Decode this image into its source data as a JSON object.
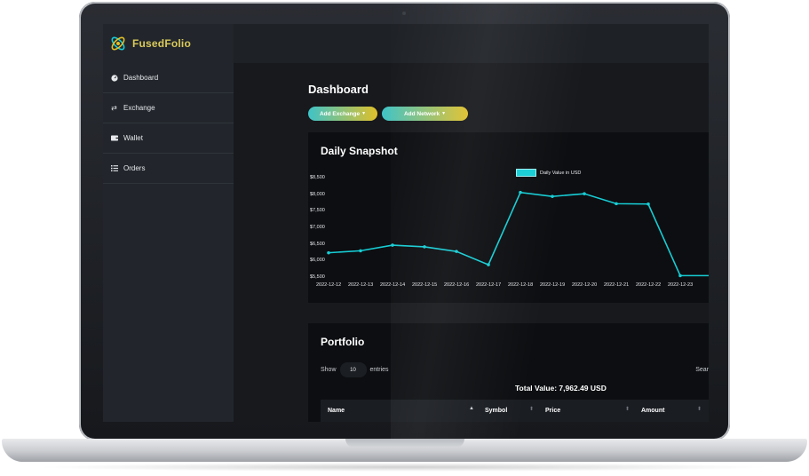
{
  "app": {
    "name": "FusedFolio"
  },
  "sidebar": {
    "items": [
      {
        "label": "Dashboard",
        "icon": "dashboard-icon"
      },
      {
        "label": "Exchange",
        "icon": "exchange-arrows-icon"
      },
      {
        "label": "Wallet",
        "icon": "wallet-icon"
      },
      {
        "label": "Orders",
        "icon": "orders-list-icon"
      }
    ]
  },
  "main": {
    "title": "Dashboard",
    "add_exchange_label": "Add Exchange",
    "add_network_label": "Add Network"
  },
  "snapshot": {
    "title": "Daily Snapshot"
  },
  "portfolio": {
    "title": "Portfolio",
    "show_label": "Show",
    "entries_value": "10",
    "entries_label": "entries",
    "search_label": "Sear",
    "total_value": "Total Value: 7,962.49 USD",
    "columns": [
      "Name",
      "Symbol",
      "Price",
      "Amount"
    ]
  },
  "colors": {
    "accent_teal": "#17cdd5",
    "accent_gold": "#e0c02a",
    "brand": "#d9c95a"
  },
  "chart_data": {
    "type": "line",
    "title": "Daily Snapshot",
    "legend": [
      "Daily Value in USD"
    ],
    "legend_position": "top-center",
    "grid": false,
    "y_tick_labels": [
      "$8,500",
      "$8,000",
      "$7,500",
      "$7,000",
      "$6,500",
      "$6,000",
      "$5,500"
    ],
    "ylim": [
      5500,
      8500
    ],
    "x": [
      "2022-12-12",
      "2022-12-13",
      "2022-12-14",
      "2022-12-15",
      "2022-12-16",
      "2022-12-17",
      "2022-12-18",
      "2022-12-19",
      "2022-12-20",
      "2022-12-21",
      "2022-12-22",
      "2022-12-23"
    ],
    "series": [
      {
        "name": "Daily Value in USD",
        "values": [
          6260,
          6320,
          6490,
          6440,
          6300,
          5900,
          8080,
          7960,
          8040,
          7740,
          7730,
          5570
        ]
      }
    ]
  }
}
